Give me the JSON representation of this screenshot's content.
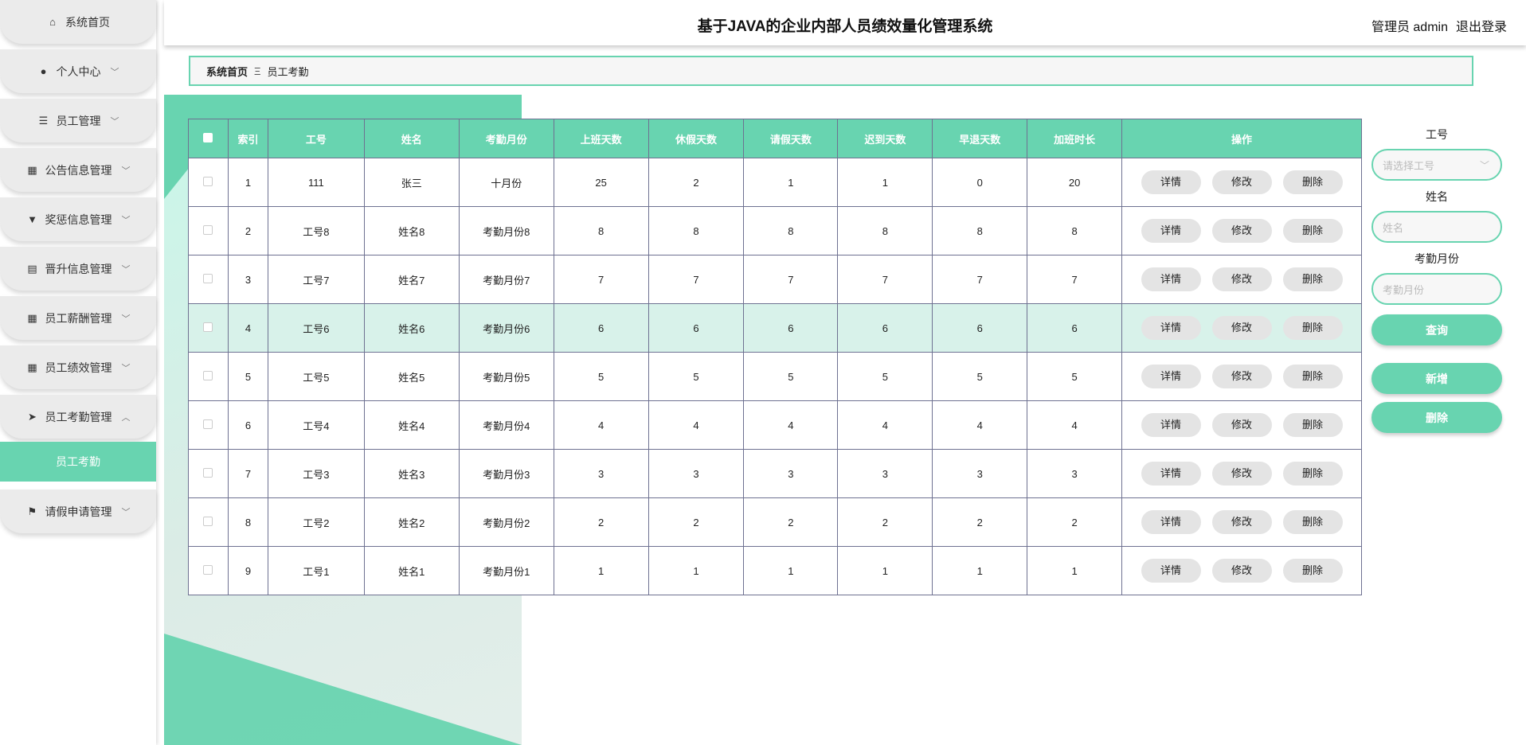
{
  "header": {
    "title": "基于JAVA的企业内部人员绩效量化管理系统",
    "user_label": "管理员 admin",
    "logout": "退出登录"
  },
  "sidebar": {
    "items": [
      {
        "label": "系统首页",
        "icon": "home-icon",
        "glyph": "⌂",
        "chev": ""
      },
      {
        "label": "个人中心",
        "icon": "user-icon",
        "glyph": "●",
        "chev": "﹀"
      },
      {
        "label": "员工管理",
        "icon": "sliders-icon",
        "glyph": "☰",
        "chev": "﹀"
      },
      {
        "label": "公告信息管理",
        "icon": "grid-icon",
        "glyph": "▦",
        "chev": "﹀"
      },
      {
        "label": "奖惩信息管理",
        "icon": "brush-icon",
        "glyph": "▼",
        "chev": "﹀"
      },
      {
        "label": "晋升信息管理",
        "icon": "clipboard-icon",
        "glyph": "▤",
        "chev": "﹀"
      },
      {
        "label": "员工薪酬管理",
        "icon": "grid-icon",
        "glyph": "▦",
        "chev": "﹀"
      },
      {
        "label": "员工绩效管理",
        "icon": "grid-icon",
        "glyph": "▦",
        "chev": "﹀"
      },
      {
        "label": "员工考勤管理",
        "icon": "send-icon",
        "glyph": "➤",
        "chev": "︿"
      },
      {
        "label": "请假申请管理",
        "icon": "flag-icon",
        "glyph": "⚑",
        "chev": "﹀"
      }
    ],
    "active_sub": "员工考勤"
  },
  "breadcrumb": {
    "home": "系统首页",
    "sep": "Ξ",
    "current": "员工考勤"
  },
  "table": {
    "headers": [
      "索引",
      "工号",
      "姓名",
      "考勤月份",
      "上班天数",
      "休假天数",
      "请假天数",
      "迟到天数",
      "早退天数",
      "加班时长",
      "操作"
    ],
    "rows": [
      [
        "1",
        "111",
        "张三",
        "十月份",
        "25",
        "2",
        "1",
        "1",
        "0",
        "20"
      ],
      [
        "2",
        "工号8",
        "姓名8",
        "考勤月份8",
        "8",
        "8",
        "8",
        "8",
        "8",
        "8"
      ],
      [
        "3",
        "工号7",
        "姓名7",
        "考勤月份7",
        "7",
        "7",
        "7",
        "7",
        "7",
        "7"
      ],
      [
        "4",
        "工号6",
        "姓名6",
        "考勤月份6",
        "6",
        "6",
        "6",
        "6",
        "6",
        "6"
      ],
      [
        "5",
        "工号5",
        "姓名5",
        "考勤月份5",
        "5",
        "5",
        "5",
        "5",
        "5",
        "5"
      ],
      [
        "6",
        "工号4",
        "姓名4",
        "考勤月份4",
        "4",
        "4",
        "4",
        "4",
        "4",
        "4"
      ],
      [
        "7",
        "工号3",
        "姓名3",
        "考勤月份3",
        "3",
        "3",
        "3",
        "3",
        "3",
        "3"
      ],
      [
        "8",
        "工号2",
        "姓名2",
        "考勤月份2",
        "2",
        "2",
        "2",
        "2",
        "2",
        "2"
      ],
      [
        "9",
        "工号1",
        "姓名1",
        "考勤月份1",
        "1",
        "1",
        "1",
        "1",
        "1",
        "1"
      ]
    ],
    "actions": [
      "详情",
      "修改",
      "删除"
    ],
    "highlighted_row": 3
  },
  "search": {
    "gonghao_label": "工号",
    "gonghao_placeholder": "请选择工号",
    "name_label": "姓名",
    "name_placeholder": "姓名",
    "month_label": "考勤月份",
    "month_placeholder": "考勤月份",
    "query": "查询",
    "add": "新增",
    "delete": "删除"
  }
}
